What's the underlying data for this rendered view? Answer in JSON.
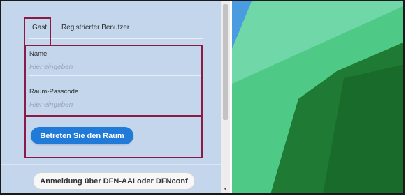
{
  "tabs": {
    "guest": "Gast",
    "registered": "Registrierter Benutzer"
  },
  "form": {
    "name_label": "Name",
    "name_placeholder": "Hier eingeben",
    "passcode_label": "Raum-Passcode",
    "passcode_placeholder": "Hier eingeben"
  },
  "actions": {
    "enter_room": "Betreten Sie den Raum",
    "dfn_login": "Anmeldung über DFN-AAI oder DFNconf"
  },
  "colors": {
    "panel_bg": "#c3d6ec",
    "primary_button": "#1f7ad8",
    "highlight": "#8b1a47"
  }
}
